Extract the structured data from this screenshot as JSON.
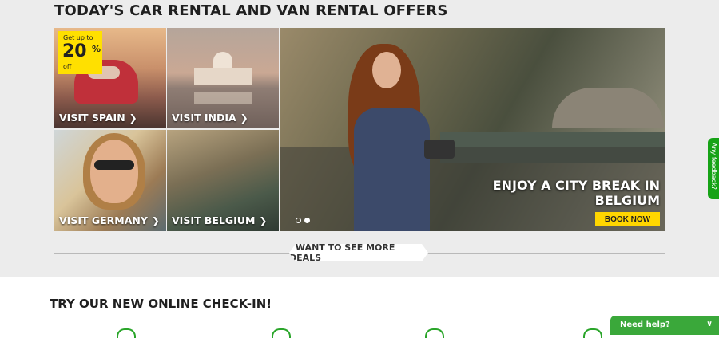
{
  "offers": {
    "title": "TODAY'S CAR RENTAL AND VAN RENTAL OFFERS",
    "promo": {
      "prefix": "Get up to",
      "amount": "20",
      "percent": "%",
      "suffix": "off"
    },
    "tiles": [
      {
        "label": "VISIT SPAIN"
      },
      {
        "label": "VISIT INDIA"
      },
      {
        "label": "VISIT GERMANY"
      },
      {
        "label": "VISIT BELGIUM"
      }
    ],
    "hero": {
      "line1": "ENJOY A CITY BREAK IN",
      "line2": "BELGIUM",
      "button": "BOOK NOW",
      "slides": 2,
      "active_slide": 2
    },
    "more_deals": "I WANT TO SEE MORE DEALS"
  },
  "checkin": {
    "title": "TRY OUR NEW ONLINE CHECK-IN!"
  },
  "feedback": {
    "label": "Any feedback?"
  },
  "chat": {
    "label": "Need help?"
  },
  "colors": {
    "accent_yellow": "#ffd600",
    "brand_green": "#2aa52a",
    "background": "#ececec"
  },
  "icons": [
    "chevron-right-icon",
    "chevron-down-icon"
  ]
}
